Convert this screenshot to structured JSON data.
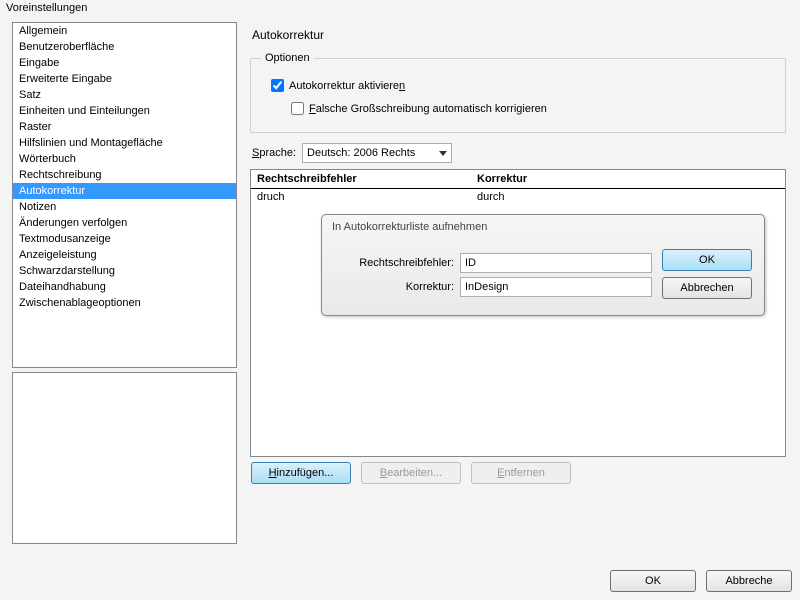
{
  "window": {
    "title": "Voreinstellungen"
  },
  "sidebar": {
    "items": [
      {
        "label": "Allgemein"
      },
      {
        "label": "Benutzeroberfläche"
      },
      {
        "label": "Eingabe"
      },
      {
        "label": "Erweiterte Eingabe"
      },
      {
        "label": "Satz"
      },
      {
        "label": "Einheiten und Einteilungen"
      },
      {
        "label": "Raster"
      },
      {
        "label": "Hilfslinien und Montagefläche"
      },
      {
        "label": "Wörterbuch"
      },
      {
        "label": "Rechtschreibung"
      },
      {
        "label": "Autokorrektur"
      },
      {
        "label": "Notizen"
      },
      {
        "label": "Änderungen verfolgen"
      },
      {
        "label": "Textmodusanzeige"
      },
      {
        "label": "Anzeigeleistung"
      },
      {
        "label": "Schwarzdarstellung"
      },
      {
        "label": "Dateihandhabung"
      },
      {
        "label": "Zwischenablageoptionen"
      }
    ],
    "selected_index": 10
  },
  "panel": {
    "title": "Autokorrektur",
    "options_legend": "Optionen",
    "activate_prefix": "Autokorrektur aktiviere",
    "activate_underline": "n",
    "activate_checked": true,
    "caps_underline": "F",
    "caps_rest": "alsche Großschreibung automatisch korrigieren",
    "caps_checked": false,
    "language_label_underline": "S",
    "language_label_rest": "prache:",
    "language_value": "Deutsch: 2006 Rechts",
    "table": {
      "col1": "Rechtschreibfehler",
      "col2": "Korrektur",
      "rows": [
        {
          "misspell": "druch",
          "correct": "durch"
        }
      ]
    },
    "inner_dialog": {
      "title": "In Autokorrekturliste aufnehmen",
      "field1_label": "Rechtschreibfehler:",
      "field1_value": "ID",
      "field2_label": "Korrektur:",
      "field2_value": "InDesign",
      "ok": "OK",
      "cancel": "Abbrechen"
    },
    "buttons": {
      "add_underline": "H",
      "add_rest": "inzufügen...",
      "edit_underline": "B",
      "edit_rest": "earbeiten...",
      "remove_underline": "E",
      "remove_rest": "ntfernen"
    }
  },
  "footer": {
    "ok": "OK",
    "cancel": "Abbreche"
  }
}
